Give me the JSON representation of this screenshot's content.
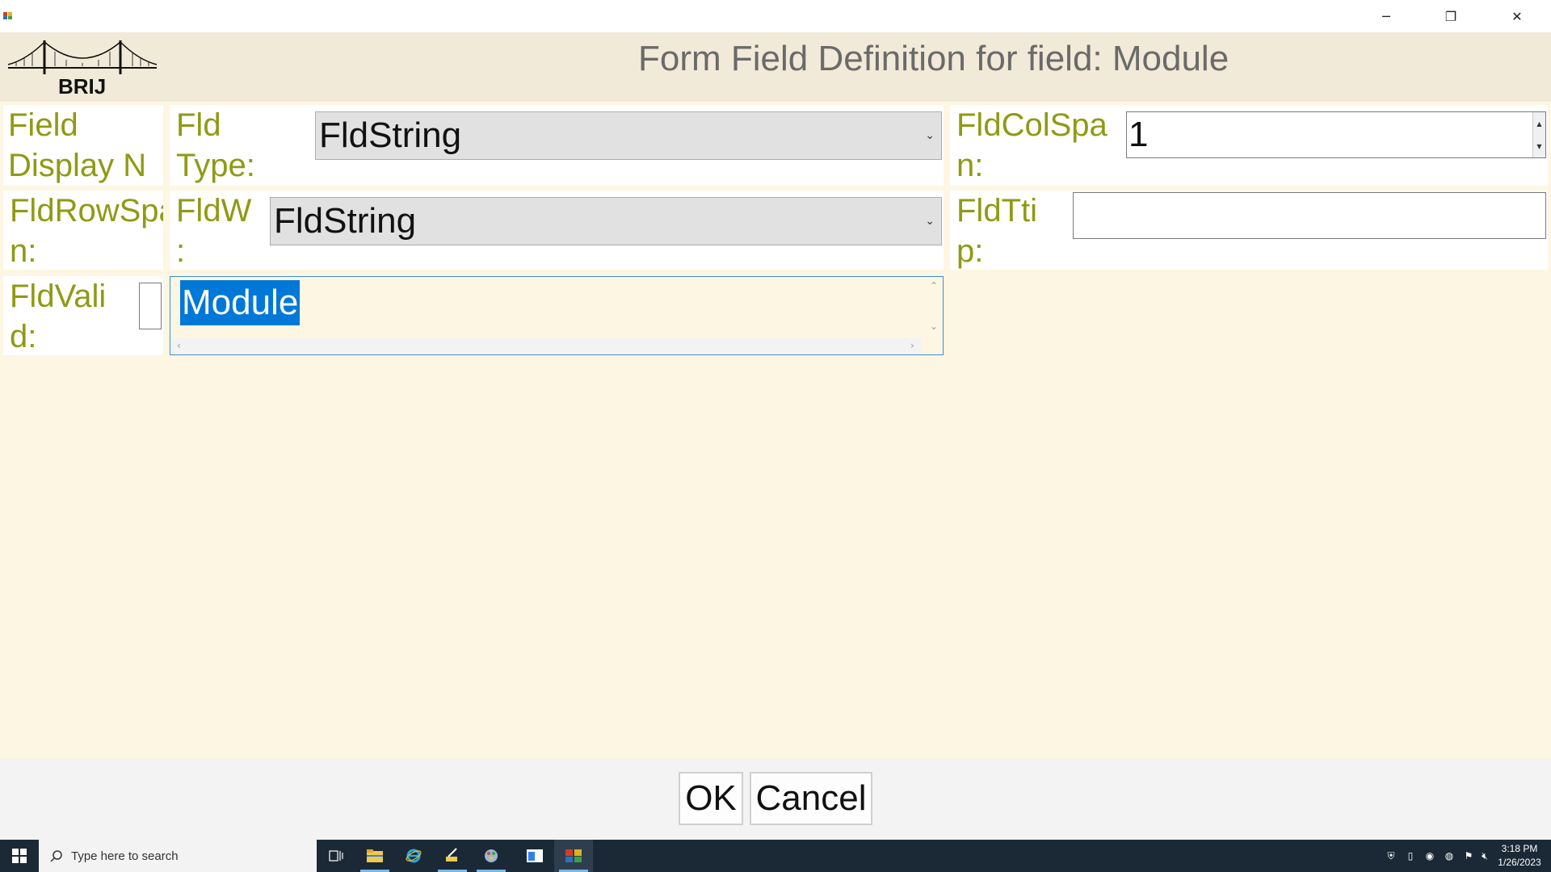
{
  "window": {
    "controls": {
      "minimize": "─",
      "restore": "❐",
      "close": "✕"
    }
  },
  "header": {
    "logo_text": "BRIJ",
    "title": "Form Field Definition for field: Module"
  },
  "form": {
    "field_display_name_label": "Field\nDisplay N",
    "fld_type_label": "Fld\nType:",
    "fld_type_value": "FldString",
    "fld_col_span_label": "FldColSpa\nn:",
    "fld_col_span_value": "1",
    "fld_row_span_label": "FldRowSpa\nn:",
    "fld_w_label": "FldW\n:",
    "fld_w_value": "FldString",
    "fld_ttip_label": "FldTti\np:",
    "fld_ttip_value": "",
    "fld_valid_label": "FldVali\nd:",
    "display_name_value": "Module"
  },
  "buttons": {
    "ok": "OK",
    "cancel": "Cancel"
  },
  "taskbar": {
    "search_placeholder": "Type here to search",
    "time": "3:18 PM",
    "date": "1/26/2023"
  },
  "colors": {
    "label": "#8f9a14",
    "header_bg": "#f1ead8",
    "content_bg": "#fdf6e3",
    "selection": "#0078d7",
    "taskbar": "#1b2936"
  }
}
